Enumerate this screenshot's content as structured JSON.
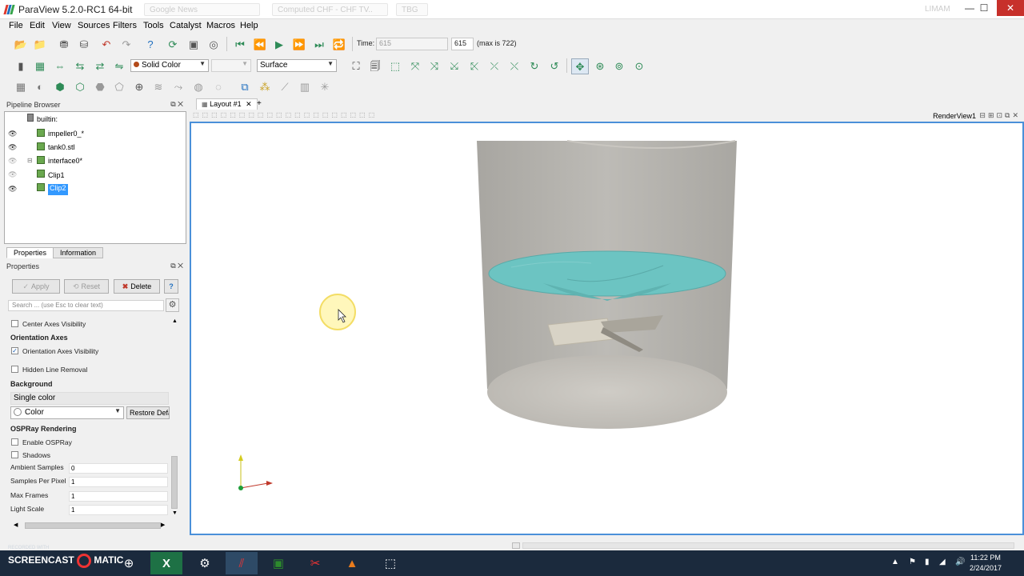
{
  "window": {
    "title": "ParaView 5.2.0-RC1 64-bit",
    "ghost_tabs": [
      "Google News",
      "Computed CHF - CHF TV..",
      "TBG"
    ],
    "ghost_label": "LIMAM"
  },
  "menu": [
    "File",
    "Edit",
    "View",
    "Sources",
    "Filters",
    "Tools",
    "Catalyst",
    "Macros",
    "Help"
  ],
  "time": {
    "label": "Time:",
    "value": "615",
    "index": "615",
    "max_text": "(max is 722)"
  },
  "toolbar2": {
    "color_mode": "Solid Color",
    "representation": "Surface"
  },
  "pipeline": {
    "header": "Pipeline Browser",
    "root": "builtin:",
    "items": [
      {
        "label": "impeller0_*",
        "visible": true
      },
      {
        "label": "tank0.stl",
        "visible": true
      },
      {
        "label": "interface0*",
        "visible": false
      },
      {
        "label": "Clip1",
        "visible": false
      },
      {
        "label": "Clip2",
        "visible": true,
        "selected": true
      }
    ]
  },
  "tabs": [
    "Properties",
    "Information"
  ],
  "properties": {
    "header": "Properties",
    "apply": "Apply",
    "reset": "Reset",
    "delete": "Delete",
    "help": "?",
    "search_placeholder": "Search ... (use Esc to clear text)",
    "center_axes": "Center Axes Visibility",
    "orientation_section": "Orientation Axes",
    "orientation_axes": "Orientation Axes Visibility",
    "hidden_line": "Hidden Line Removal",
    "background_section": "Background",
    "background_mode": "Single color",
    "color_label": "Color",
    "restore": "Restore Defa",
    "ospray_section": "OSPRay Rendering",
    "enable_ospray": "Enable OSPRay",
    "shadows": "Shadows",
    "fields": [
      {
        "label": "Ambient Samples",
        "value": "0"
      },
      {
        "label": "Samples Per Pixel",
        "value": "1"
      },
      {
        "label": "Max Frames",
        "value": "1"
      },
      {
        "label": "Light Scale",
        "value": "1"
      }
    ]
  },
  "layout": {
    "tab": "Layout #1",
    "add": "+",
    "render_view": "RenderView1"
  },
  "taskbar": {
    "watermark_top": "RECORDED WITH",
    "watermark": "SCREENCAST",
    "watermark2": "MATIC",
    "time": "11:22 PM",
    "date": "2/24/2017"
  },
  "colors": {
    "accent": "#4a90d9",
    "selection": "#3399ff",
    "tank": "#b5b3ae",
    "fluid": "#66c2c2",
    "taskbar": "#1b2a3d",
    "close": "#c7302b"
  }
}
